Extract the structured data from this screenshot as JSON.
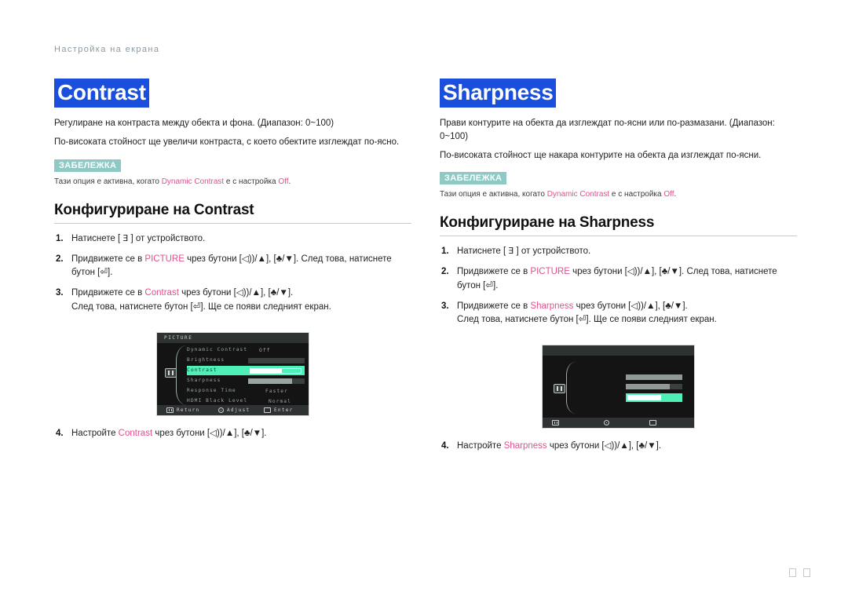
{
  "breadcrumb": "Настройка на екрана",
  "footer": {
    "glyph1": "",
    "glyph2": ""
  },
  "left": {
    "title": "Contrast",
    "desc1": "Регулиране на контраста между обекта и фона. (Диапазон: 0~100)",
    "desc2": "По-високата стойност ще увеличи контраста, с което обектите изглеждат по-ясно.",
    "note_badge": "ЗАБЕЛЕЖКА",
    "note_pre": "Тази опция е активна, когато ",
    "note_term": "Dynamic Contrast",
    "note_mid": " е с настройка ",
    "note_val": "Off",
    "note_end": ".",
    "config_heading": "Конфигуриране на Contrast",
    "steps": [
      {
        "num": "1.",
        "pre": "Натиснете [ ",
        "glyph": "Ǝ",
        "post": " ] от устройството."
      },
      {
        "num": "2.",
        "pre": "Придвижете се в ",
        "term": "PICTURE",
        "post": " чрез бутони [◁))/▲], [♣/▼]. След това, натиснете бутон [⏎]."
      },
      {
        "num": "3.",
        "pre": "Придвижете се в ",
        "term": "Contrast",
        "post": " чрез бутони [◁))/▲], [♣/▼].",
        "line2": "След това, натиснете бутон [⏎]. Ще се появи следният екран."
      }
    ],
    "step4": {
      "num": "4.",
      "pre": "Настройте ",
      "term": "Contrast",
      "post": " чрез бутони [◁))/▲], [♣/▼]."
    },
    "osd": {
      "title": "PICTURE",
      "rows": [
        {
          "label": "Dynamic Contrast",
          "value": "Off",
          "type": "text",
          "selected": false
        },
        {
          "label": "Brightness",
          "type": "bar",
          "fill": 0,
          "selected": false
        },
        {
          "label": "Contrast",
          "type": "bar",
          "fill": 62,
          "selected": true
        },
        {
          "label": "Sharpness",
          "type": "bar",
          "fill": 78,
          "selected": false
        },
        {
          "label": "Response Time",
          "value": "Faster",
          "type": "text",
          "selected": false
        },
        {
          "label": "HDMI Black Level",
          "value": "Normal",
          "type": "text",
          "selected": false
        }
      ],
      "footer": [
        {
          "icon": "menu-icon",
          "label": "Return"
        },
        {
          "icon": "adjust-icon",
          "label": "Adjust"
        },
        {
          "icon": "enter-icon",
          "label": "Enter"
        }
      ]
    }
  },
  "right": {
    "title": "Sharpness",
    "desc1": "Прави контурите на обекта да изглеждат по-ясни или по-размазани. (Диапазон: 0~100)",
    "desc2": "По-високата стойност ще накара контурите на обекта да изглеждат по-ясни.",
    "note_badge": "ЗАБЕЛЕЖКА",
    "note_pre": "Тази опция е активна, когато ",
    "note_term": "Dynamic Contrast",
    "note_mid": " е с настройка ",
    "note_val": "Off",
    "note_end": ".",
    "config_heading": "Конфигуриране на Sharpness",
    "steps": [
      {
        "num": "1.",
        "pre": "Натиснете [ ",
        "glyph": "Ǝ",
        "post": " ] от устройството."
      },
      {
        "num": "2.",
        "pre": "Придвижете се в ",
        "term": "PICTURE",
        "post": " чрез бутони [◁))/▲], [♣/▼]. След това, натиснете бутон [⏎]."
      },
      {
        "num": "3.",
        "pre": "Придвижете се в ",
        "term": "Sharpness",
        "post": " чрез бутони [◁))/▲], [♣/▼].",
        "line2": "След това, натиснете бутон [⏎]. Ще се появи следният екран."
      }
    ],
    "step4": {
      "num": "4.",
      "pre": "Настройте ",
      "term": "Sharpness",
      "post": " чрез бутони [◁))/▲], [♣/▼]."
    },
    "osd": {
      "title": "",
      "bars": [
        {
          "fill": 100,
          "selected": false
        },
        {
          "fill": 78,
          "selected": false
        },
        {
          "fill": 62,
          "selected": true
        }
      ],
      "footer": [
        {
          "icon": "menu-icon",
          "label": ""
        },
        {
          "icon": "adjust-icon",
          "label": ""
        },
        {
          "icon": "enter-icon",
          "label": ""
        }
      ]
    }
  },
  "colors": {
    "title_highlight": "#1a4edd",
    "note_badge": "#8fc9c4",
    "accent_pink": "#e24f8e",
    "osd_selected": "#4ef0b6"
  }
}
